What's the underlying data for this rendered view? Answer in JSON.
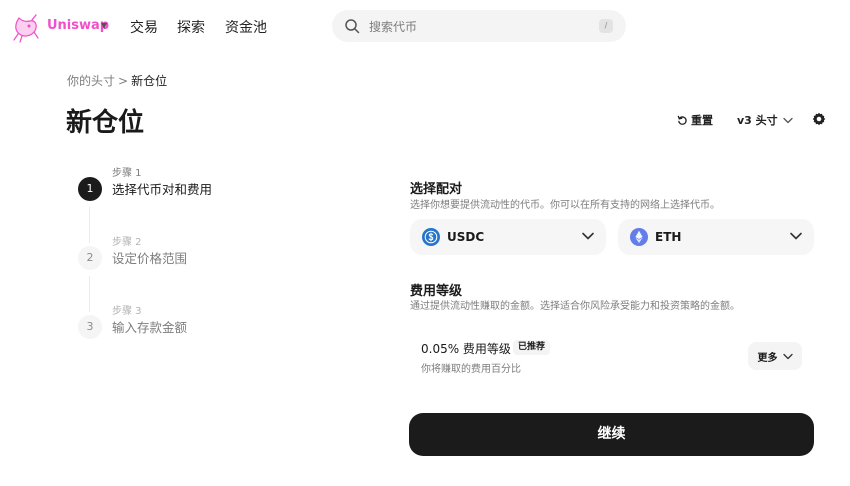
{
  "nav": {
    "brand": "Uniswap",
    "links": [
      "交易",
      "探索",
      "资金池"
    ],
    "search_placeholder": "搜索代币",
    "search_shortcut": "/"
  },
  "breadcrumb": {
    "parent": "你的头寸",
    "separator": ">",
    "current": "新仓位"
  },
  "page_title": "新仓位",
  "toolbar": {
    "reset_label": "重置",
    "version_label": "v3 头寸"
  },
  "steps": [
    {
      "number": "1",
      "small": "步骤 1",
      "title": "选择代币对和费用",
      "active": true
    },
    {
      "number": "2",
      "small": "步骤 2",
      "title": "设定价格范围",
      "active": false
    },
    {
      "number": "3",
      "small": "步骤 3",
      "title": "输入存款金额",
      "active": false
    }
  ],
  "pair": {
    "title": "选择配对",
    "description": "选择你想要提供流动性的代币。你可以在所有支持的网络上选择代币。",
    "token_a": {
      "symbol": "USDC",
      "icon": "usdc-icon"
    },
    "token_b": {
      "symbol": "ETH",
      "icon": "eth-icon"
    }
  },
  "fee": {
    "title": "费用等级",
    "description": "通过提供流动性赚取的金额。选择适合你风险承受能力和投资策略的金额。",
    "value": "0.05% 费用等级",
    "badge": "已推荐",
    "subtitle": "你将赚取的费用百分比",
    "more_label": "更多"
  },
  "continue_label": "继续",
  "colors": {
    "brand": "#f050c8",
    "usdc": "#2775ca",
    "eth": "#627eea",
    "primary_button": "#1b1b1b"
  }
}
